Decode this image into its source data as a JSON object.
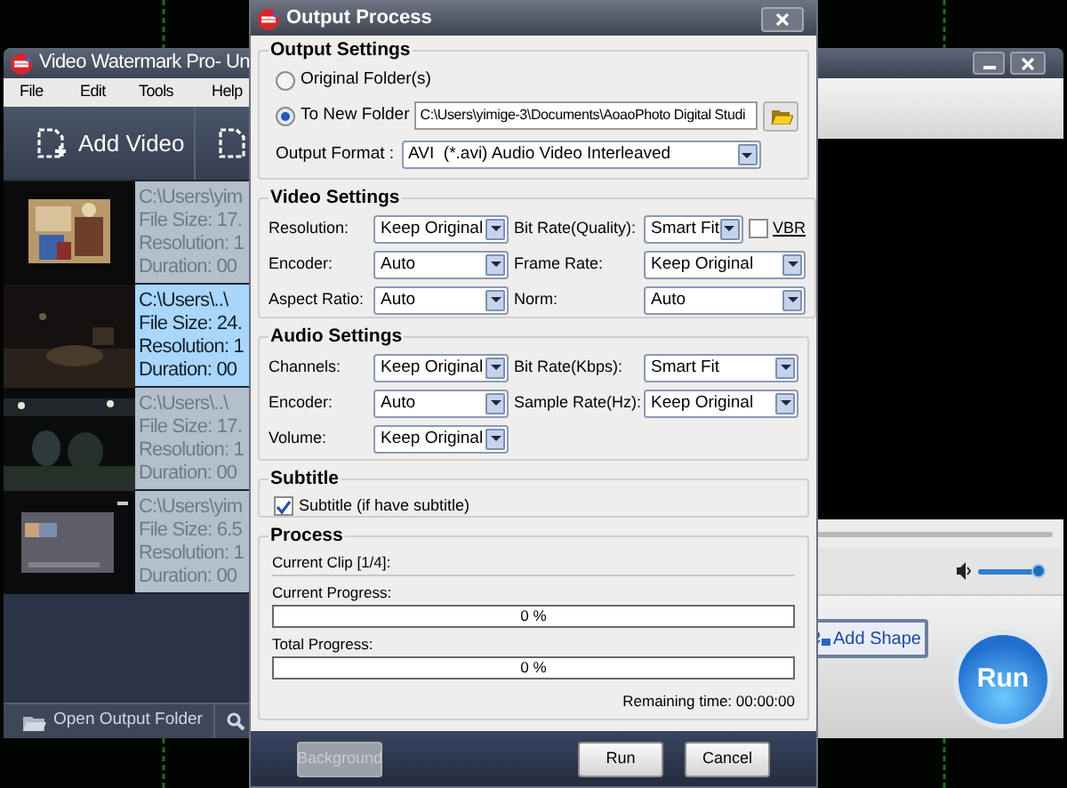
{
  "main_window": {
    "title": "Video Watermark Pro- Un",
    "menu": [
      "File",
      "Edit",
      "Tools",
      "Help"
    ],
    "add_video": "Add Video",
    "videos": [
      {
        "path": "C:\\Users\\yim",
        "file_size": "File Size: 17.",
        "resolution": "Resolution: 1",
        "duration": "Duration: 00",
        "selected": false
      },
      {
        "path": "C:\\Users\\..\\",
        "file_size": "File Size: 24.",
        "resolution": "Resolution: 1",
        "duration": "Duration: 00",
        "selected": true
      },
      {
        "path": "C:\\Users\\..\\",
        "file_size": "File Size: 17.",
        "resolution": "Resolution: 1",
        "duration": "Duration: 00",
        "selected": false
      },
      {
        "path": "C:\\Users\\yim",
        "file_size": "File Size: 6.5",
        "resolution": "Resolution: 1",
        "duration": "Duration: 00",
        "selected": false
      }
    ],
    "open_output_folder": "Open Output Folder",
    "volume": {
      "level": 0.9
    },
    "add_shape": "Add Shape",
    "run": "Run"
  },
  "dialog": {
    "title": "Output Process",
    "output_settings": {
      "title": "Output Settings",
      "destinations": [
        {
          "label": "Original Folder(s)",
          "selected": false
        },
        {
          "label": "To New Folder",
          "selected": true
        }
      ],
      "folder_path": "C:\\Users\\yimige-3\\Documents\\AoaoPhoto Digital Studi",
      "format_label": "Output Format :",
      "format": "AVI  (*.avi) Audio Video Interleaved"
    },
    "video_settings": {
      "title": "Video Settings",
      "fields": [
        {
          "label": "Resolution:",
          "value": "Keep Original"
        },
        {
          "label": "Bit Rate(Quality):",
          "value": "Smart Fit",
          "vbr": {
            "label": "VBR",
            "checked": false
          }
        },
        {
          "label": "Encoder:",
          "value": "Auto"
        },
        {
          "label": "Frame Rate:",
          "value": "Keep Original"
        },
        {
          "label": "Aspect Ratio:",
          "value": "Auto"
        },
        {
          "label": "Norm:",
          "value": "Auto"
        }
      ]
    },
    "audio_settings": {
      "title": "Audio Settings",
      "fields": [
        {
          "label": "Channels:",
          "value": "Keep Original"
        },
        {
          "label": "Bit Rate(Kbps):",
          "value": "Smart Fit"
        },
        {
          "label": "Encoder:",
          "value": "Auto"
        },
        {
          "label": "Sample Rate(Hz):",
          "value": "Keep Original"
        },
        {
          "label": "Volume:",
          "value": "Keep Original"
        }
      ]
    },
    "subtitle": {
      "title": "Subtitle",
      "label": "Subtitle (if have subtitle)",
      "checked": true
    },
    "process": {
      "title": "Process",
      "current_clip": "Current Clip [1/4]:",
      "bars": [
        {
          "label": "Current Progress:",
          "level": 0,
          "reading": "0 %"
        },
        {
          "label": "Total Progress:",
          "level": 0,
          "reading": "0 %"
        }
      ],
      "remaining": "Remaining time: 00:00:00"
    },
    "buttons": [
      {
        "label": "Background",
        "disabled": true
      },
      {
        "label": "Run",
        "disabled": false
      },
      {
        "label": "Cancel",
        "disabled": false
      }
    ]
  }
}
